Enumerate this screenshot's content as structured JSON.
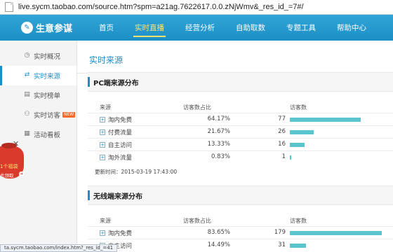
{
  "browser": {
    "url": "live.sycm.taobao.com/source.htm?spm=a21ag.7622617.0.0.zNjWmv&_res_id_=7#/"
  },
  "header": {
    "logo_text": "生意参谋",
    "nav": [
      "首页",
      "实时直播",
      "经营分析",
      "自助取数",
      "专题工具",
      "帮助中心"
    ],
    "active_nav": "实时直播"
  },
  "sidebar": {
    "items": [
      {
        "label": "实时概况",
        "icon": "clock-icon"
      },
      {
        "label": "实时来源",
        "icon": "arrows-icon"
      },
      {
        "label": "实时榜单",
        "icon": "ranking-icon"
      },
      {
        "label": "实时访客",
        "icon": "visitor-icon",
        "badge": "NEW"
      },
      {
        "label": "活动看板",
        "icon": "activity-icon"
      }
    ],
    "active": "实时来源"
  },
  "promo": {
    "line1": "1个福袋",
    "line2": "此领取"
  },
  "main": {
    "title": "实时来源",
    "pc": {
      "heading": "PC端来源分布",
      "headers": [
        "来源",
        "访客数占比",
        "访客数"
      ],
      "rows": [
        {
          "source": "淘内免费",
          "pct": "64.17%",
          "count": "77",
          "share": 0.6417
        },
        {
          "source": "付费流量",
          "pct": "21.67%",
          "count": "26",
          "share": 0.2167
        },
        {
          "source": "自主访问",
          "pct": "13.33%",
          "count": "16",
          "share": 0.1333
        },
        {
          "source": "淘外流量",
          "pct": "0.83%",
          "count": "1",
          "share": 0.0083
        }
      ],
      "updated": "更新时间：2015-03-19 17:43:00"
    },
    "mobile": {
      "heading": "无线端来源分布",
      "headers": [
        "来源",
        "访客数占比",
        "访客数"
      ],
      "rows": [
        {
          "source": "淘内免费",
          "pct": "83.65%",
          "count": "179",
          "share": 0.8365
        },
        {
          "source": "自主访问",
          "pct": "14.49%",
          "count": "31",
          "share": 0.1449
        }
      ]
    }
  },
  "status_bar": {
    "text": "ta.sycm.taobao.com/index.htm?_res_id_=41"
  },
  "colors": {
    "header": "#1c8fc6",
    "accent": "#1c8fc6",
    "bar": "#5cc4cf",
    "active_nav": "#ffe36e"
  }
}
